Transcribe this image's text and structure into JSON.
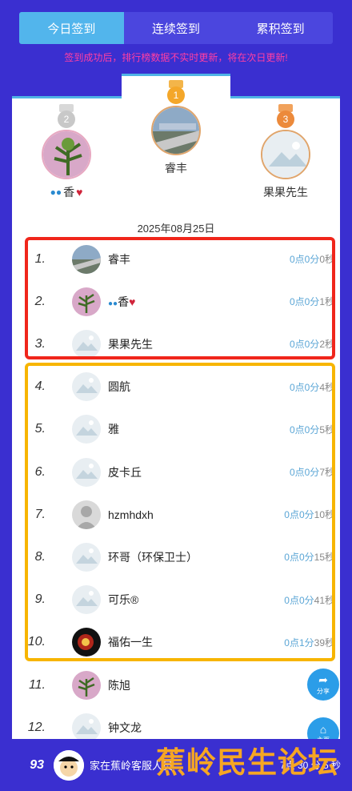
{
  "tabs": [
    {
      "label": "今日签到",
      "active": true
    },
    {
      "label": "连续签到",
      "active": false
    },
    {
      "label": "累积签到",
      "active": false
    }
  ],
  "notice": "签到成功后，排行榜数据不实时更新，将在次日更新!",
  "podium": {
    "first": {
      "name": "睿丰",
      "medal": "gold"
    },
    "second": {
      "name": "香",
      "medal": "silver"
    },
    "third": {
      "name": "果果先生",
      "medal": "bronze"
    }
  },
  "date": "2025年08月25日",
  "rows": [
    {
      "rank": "1.",
      "name": "睿丰",
      "time_a": "0点0分",
      "time_b": "0秒",
      "avatar": "photo"
    },
    {
      "rank": "2.",
      "name": "香",
      "time_a": "0点0分",
      "time_b": "1秒",
      "avatar": "plant"
    },
    {
      "rank": "3.",
      "name": "果果先生",
      "time_a": "0点0分",
      "time_b": "2秒",
      "avatar": "default"
    },
    {
      "rank": "4.",
      "name": "圆航",
      "time_a": "0点0分",
      "time_b": "4秒",
      "avatar": "default"
    },
    {
      "rank": "5.",
      "name": "雅",
      "time_a": "0点0分",
      "time_b": "5秒",
      "avatar": "default"
    },
    {
      "rank": "6.",
      "name": "皮卡丘",
      "time_a": "0点0分",
      "time_b": "7秒",
      "avatar": "default"
    },
    {
      "rank": "7.",
      "name": "hzmhdxh",
      "time_a": "0点0分",
      "time_b": "10秒",
      "avatar": "gray"
    },
    {
      "rank": "8.",
      "name": "环哥（环保卫士）",
      "time_a": "0点0分",
      "time_b": "15秒",
      "avatar": "default"
    },
    {
      "rank": "9.",
      "name": "可乐®",
      "time_a": "0点0分",
      "time_b": "41秒",
      "avatar": "default"
    },
    {
      "rank": "10.",
      "name": "福佑一生",
      "time_a": "0点1分",
      "time_b": "39秒",
      "avatar": "dark"
    },
    {
      "rank": "11.",
      "name": "陈旭",
      "time_a": "0点8",
      "time_b": "",
      "avatar": "plant"
    },
    {
      "rank": "12.",
      "name": "钟文龙",
      "time_a": "0点8",
      "time_b": "",
      "avatar": "default"
    }
  ],
  "fabs": {
    "share": "分享",
    "home": "主页"
  },
  "footer": {
    "rank": "93",
    "name": "家在蕉岭客服人员",
    "time": "7点 30 分 5 秒"
  },
  "watermark": "蕉岭民生论坛",
  "colors": {
    "bg": "#3a2fd0",
    "active_tab": "#52b5ec",
    "notice": "#ff3fa3",
    "red_box": "#f0261b",
    "yellow_box": "#f7b500",
    "time": "#5ba6d6"
  }
}
